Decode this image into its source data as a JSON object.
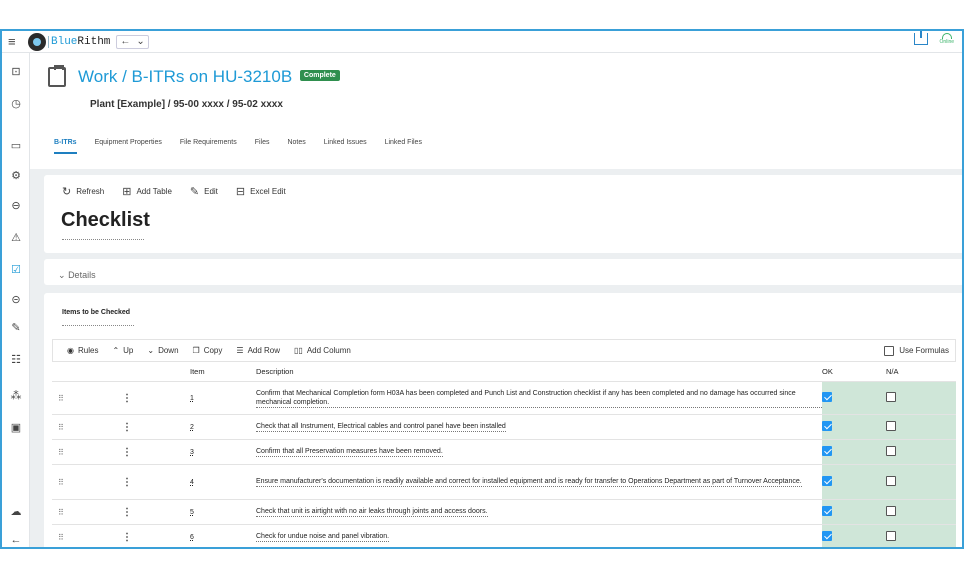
{
  "app": {
    "name_prefix": "Blue",
    "name_suffix": "Rithm",
    "online_label": "Online",
    "nav_back": "←",
    "nav_dropdown": "⌄"
  },
  "header": {
    "title_work": "Work / B-ITRs",
    "title_on": "on HU-3210B",
    "status_badge": "Complete",
    "subtitle": "Plant [Example] / 95-00 xxxx / 95-02 xxxx",
    "tabs": [
      "B-ITRs",
      "Equipment Properties",
      "File Requirements",
      "Files",
      "Notes",
      "Linked Issues",
      "Linked Files"
    ]
  },
  "toolbar": {
    "refresh": "Refresh",
    "add_table": "Add Table",
    "edit": "Edit",
    "excel_edit": "Excel Edit"
  },
  "checklist": {
    "title": "Checklist",
    "details_label": "Details"
  },
  "items_section": {
    "title": "Items to be Checked",
    "actions": {
      "rules": "Rules",
      "up": "Up",
      "down": "Down",
      "copy": "Copy",
      "add_row": "Add Row",
      "add_column": "Add Column",
      "use_formulas": "Use Formulas"
    },
    "columns": {
      "item": "Item",
      "description": "Description",
      "ok": "OK",
      "na": "N/A"
    },
    "rows": [
      {
        "item": "1",
        "description": "Confirm that Mechanical Completion form H03A has been completed and Punch List and Construction checklist if any has been completed and no damage has occurred since mechanical completion.",
        "ok": true,
        "na": false
      },
      {
        "item": "2",
        "description": "Check that all Instrument, Electrical cables and control panel have been installed",
        "ok": true,
        "na": false
      },
      {
        "item": "3",
        "description": "Confirm that all Preservation measures have been removed.",
        "ok": true,
        "na": false
      },
      {
        "item": "4",
        "description": "Ensure manufacturer's documentation is readily available and correct for installed equipment and is ready for transfer to Operations Department as part of Turnover Acceptance.",
        "ok": true,
        "na": false
      },
      {
        "item": "5",
        "description": "Check that unit is airtight with no air leaks through joints and access doors.",
        "ok": true,
        "na": false
      },
      {
        "item": "6",
        "description": "Check for undue noise and panel vibration.",
        "ok": true,
        "na": false
      }
    ]
  }
}
